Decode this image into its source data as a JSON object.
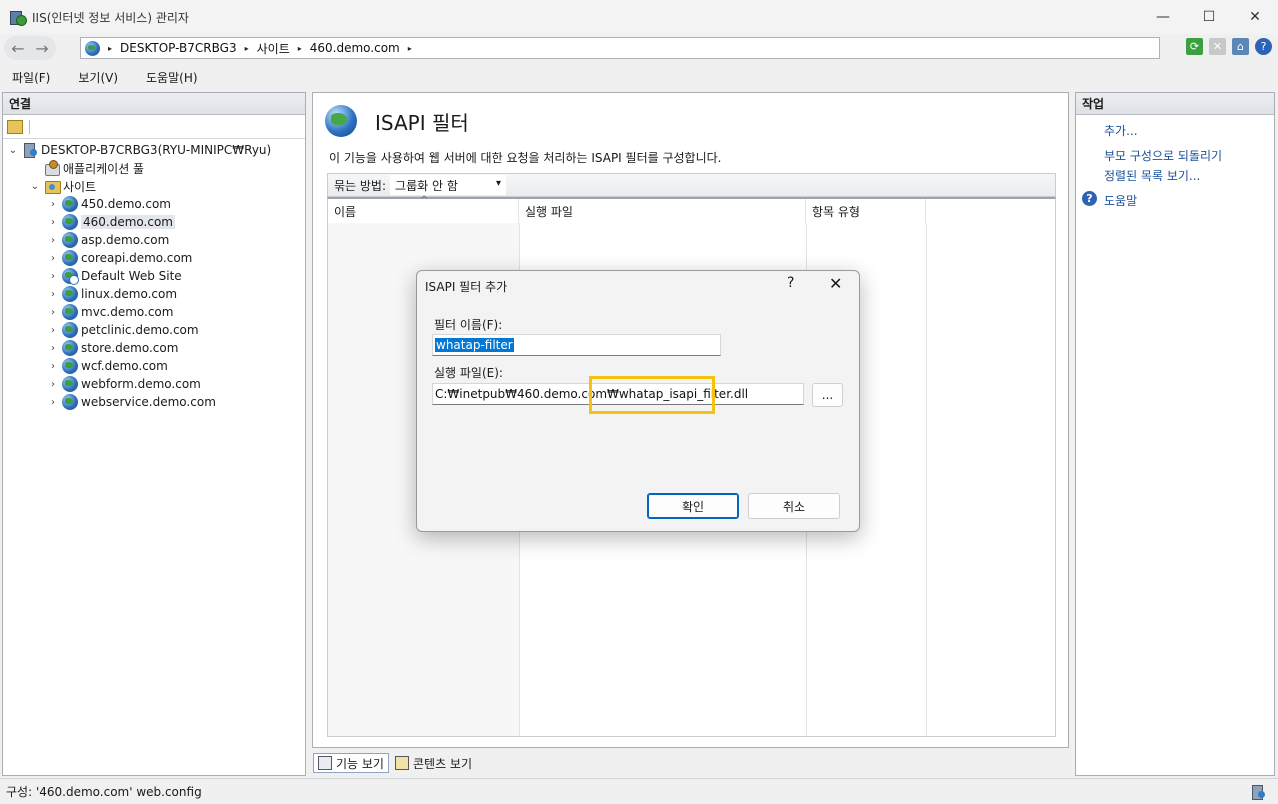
{
  "window": {
    "title": "IIS(인터넷 정보 서비스) 관리자",
    "controls": {
      "minimize": "—",
      "maximize": "☐",
      "close": "✕"
    }
  },
  "address": {
    "back": "←",
    "forward": "→",
    "crumbs": [
      "DESKTOP-B7CRBG3",
      "사이트",
      "460.demo.com"
    ],
    "arrow": "▸"
  },
  "menu": [
    "파일(F)",
    "보기(V)",
    "도움말(H)"
  ],
  "connections": {
    "header": "연결",
    "server": "DESKTOP-B7CRBG3(RYU-MINIPC₩Ryu)",
    "app_pools": "애플리케이션 풀",
    "sites_label": "사이트",
    "sites": [
      "450.demo.com",
      "460.demo.com",
      "asp.demo.com",
      "coreapi.demo.com",
      "Default Web Site",
      "linux.demo.com",
      "mvc.demo.com",
      "petclinic.demo.com",
      "store.demo.com",
      "wcf.demo.com",
      "webform.demo.com",
      "webservice.demo.com"
    ],
    "selected_site": "460.demo.com"
  },
  "main": {
    "title": "ISAPI 필터",
    "description": "이 기능을 사용하여 웹 서버에 대한 요청을 처리하는 ISAPI 필터를 구성합니다.",
    "group_by_label": "묶는 방법:",
    "group_by_value": "그룹화 안 함",
    "columns": [
      "이름",
      "실행 파일",
      "항목 유형"
    ],
    "sort_arrow": "^"
  },
  "bottom_tabs": {
    "features": "기능 보기",
    "content": "콘텐츠 보기"
  },
  "actions": {
    "header": "작업",
    "add": "추가...",
    "revert": "부모 구성으로 되돌리기",
    "view_ordered": "정렬된 목록 보기...",
    "help": "도움말",
    "help_glyph": "?"
  },
  "status": {
    "text": "구성: '460.demo.com' web.config"
  },
  "dialog": {
    "title": "ISAPI 필터 추가",
    "help": "?",
    "close": "✕",
    "filter_name_label": "필터 이름(F):",
    "filter_name_value": "whatap-filter",
    "executable_label": "실행 파일(E):",
    "executable_value": "C:₩inetpub₩460.demo.com₩whatap_isapi_filter.dll",
    "browse": "...",
    "ok": "확인",
    "cancel": "취소",
    "highlight_color": "#f5c211"
  }
}
